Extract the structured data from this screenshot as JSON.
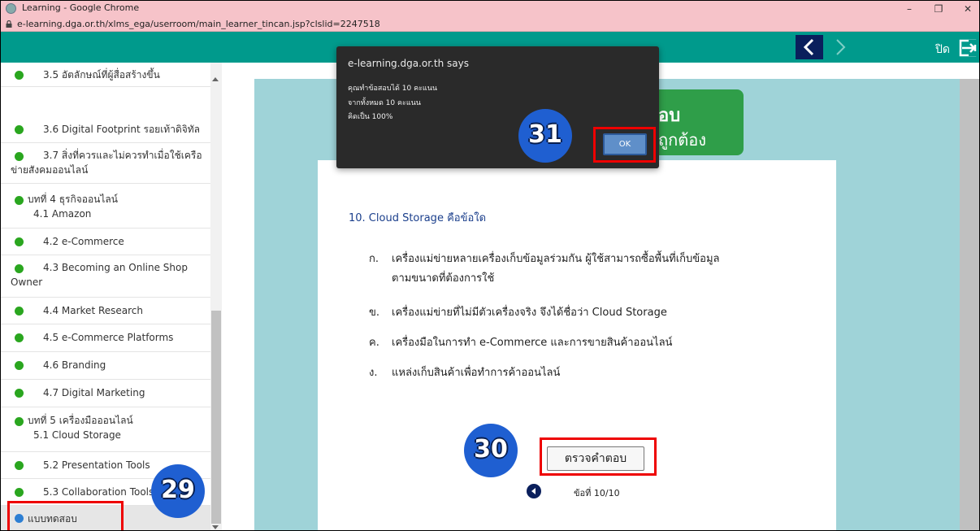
{
  "window": {
    "title": "Learning - Google Chrome",
    "controls": {
      "minimize": "–",
      "maximize": "❐",
      "close": "✕"
    }
  },
  "address": {
    "url": "e-learning.dga.or.th/xlms_ega/userroom/main_learner_tincan.jsp?clslid=2247518"
  },
  "topbar": {
    "close_label": "ปิด"
  },
  "sidebar": {
    "items": [
      {
        "label": "3.5 อัตลักษณ์ที่ผู้สื่อสร้างขึ้น"
      },
      {
        "label": "3.6 Digital Footprint รอยเท้าดิจิทัล"
      },
      {
        "label": "3.7 สิ่งที่ควรและไม่ควรทำเมื่อใช้เครือ",
        "label2": "ข่ายสังคมออนไลน์"
      },
      {
        "label": "บทที่ 4 ธุรกิจออนไลน์",
        "label2": "4.1 Amazon"
      },
      {
        "label": "4.2 e-Commerce"
      },
      {
        "label": "4.3 Becoming an Online Shop",
        "label2": "Owner"
      },
      {
        "label": "4.4 Market Research"
      },
      {
        "label": "4.5 e-Commerce Platforms"
      },
      {
        "label": "4.6 Branding"
      },
      {
        "label": "4.7 Digital Marketing"
      },
      {
        "label": "บทที่ 5 เครื่องมือออนไลน์",
        "label2": "5.1 Cloud Storage"
      },
      {
        "label": "5.2 Presentation Tools"
      },
      {
        "label": "5.3 Collaboration Tools"
      },
      {
        "label": "แบบทดสอบ"
      }
    ]
  },
  "result_badge": {
    "line1": "อบ",
    "line2": "ถูกต้อง"
  },
  "quiz": {
    "question": "10. Cloud Storage คือข้อใด",
    "choices": [
      {
        "letter": "ก.",
        "text": "เครื่องแม่ข่ายหลายเครื่องเก็บข้อมูลร่วมกัน ผู้ใช้สามารถซื้อพื้นที่เก็บข้อมูล",
        "text2": "ตามขนาดที่ต้องการใช้"
      },
      {
        "letter": "ข.",
        "text": "เครื่องแม่ข่ายที่ไม่มีตัวเครื่องจริง จึงได้ชื่อว่า Cloud Storage"
      },
      {
        "letter": "ค.",
        "text": "เครื่องมือในการทำ e-Commerce และการขายสินค้าออนไลน์"
      },
      {
        "letter": "ง.",
        "text": "แหล่งเก็บสินค้าเพื่อทำการค้าออนไลน์"
      }
    ],
    "check_button": "ตรวจคำตอบ",
    "page_label": "ข้อที่ 10/10"
  },
  "alert": {
    "origin": "e-learning.dga.or.th says",
    "line1": "คุณทำข้อสอบได้ 10 คะแนน",
    "line2": "จากทั้งหมด 10 คะแนน",
    "line3": "คิดเป็น 100%",
    "ok_label": "OK"
  },
  "callouts": {
    "c29": "29",
    "c30": "30",
    "c31": "31"
  },
  "colors": {
    "titlebar": "#f6c3c9",
    "topbar": "#009a8c",
    "panel": "#9fd3d8",
    "badge_green": "#2f9e49",
    "dot_green": "#2aa61f",
    "dot_blue": "#2d7fd3",
    "callout_blue": "#1f5fd1",
    "highlight_red": "#e00000"
  }
}
